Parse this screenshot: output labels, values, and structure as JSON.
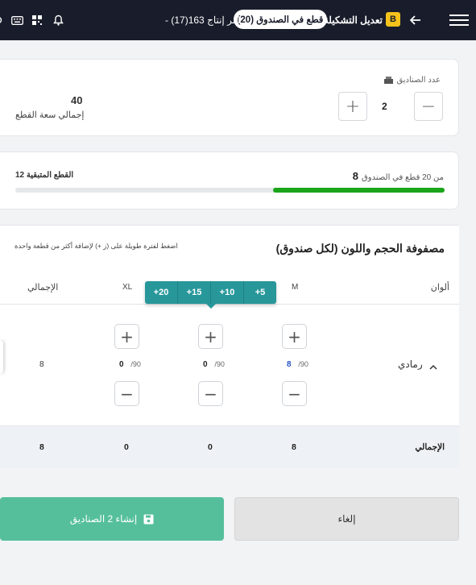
{
  "header": {
    "badge": "B",
    "title": "تعديل التشكيلة",
    "pill": "(20) قطع في الصندوق",
    "order": "- أمر إنتاج 163(17)"
  },
  "boxes": {
    "label": "عدد الصناديق",
    "count": "2",
    "plus": "+",
    "minus": "−",
    "total_value": "40",
    "total_label": "إجمالي سعة القطع"
  },
  "progress": {
    "current": "8",
    "suffix": "من 20 قطع في الصندوق",
    "remaining": "12 القطع المتبقية",
    "fill_fraction": 0.4,
    "color": "#1aa41a"
  },
  "matrix": {
    "title": "مصفوفة الحجم واللون (لكل صندوق)",
    "hint": "اضغط لفترة طويلة على (ز +) لإضافة أكثر من قطعة واحدة",
    "columns": {
      "color": "ألوان",
      "m": "M",
      "xl": "XL",
      "total": "الإجمالي"
    },
    "tooltip": [
      "+5",
      "+10",
      "+15",
      "+20"
    ],
    "row": {
      "color": "رمادي",
      "m": {
        "value": "8",
        "max": "/90"
      },
      "c2": {
        "value": "0",
        "max": "/90"
      },
      "c3": {
        "value": "0",
        "max": "/90"
      },
      "total": "8"
    },
    "totals": {
      "label": "الإجمالي",
      "m": "8",
      "c2": "0",
      "c3": "0",
      "total": "8"
    }
  },
  "actions": {
    "create": "إنشاء  2  الصناديق",
    "cancel": "إلغاء"
  },
  "colors": {
    "accent": "#55bf9c",
    "teal": "#27979a",
    "dark": "#191d2b"
  }
}
